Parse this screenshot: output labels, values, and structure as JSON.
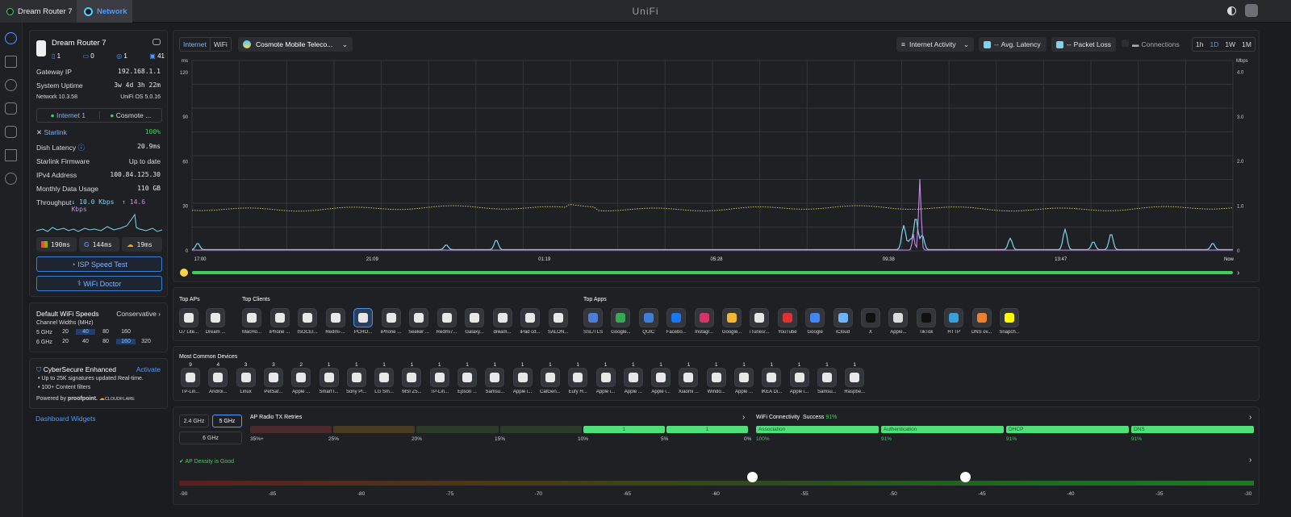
{
  "topbar": {
    "tab_router": "Dream Router 7",
    "tab_network": "Network",
    "brand": "UniFi"
  },
  "side_icons": [
    "dashboard-icon",
    "topology-icon",
    "devices-icon",
    "clients-icon",
    "insights-icon",
    "stats-icon",
    "protect-icon"
  ],
  "device": {
    "name": "Dream Router 7",
    "stats": [
      {
        "icon": "ap-icon",
        "value": "1"
      },
      {
        "icon": "switch-icon",
        "value": "0"
      },
      {
        "icon": "camera-icon",
        "value": "1"
      },
      {
        "icon": "clients-icon",
        "value": "41"
      }
    ],
    "gateway_ip_label": "Gateway IP",
    "gateway_ip": "192.168.1.1",
    "uptime_label": "System Uptime",
    "uptime": "3w 4d 3h 22m",
    "network_version": "Network 10.3.58",
    "os_version": "UniFi OS 5.0.16",
    "wan1": "Internet 1",
    "wan2": "Cosmote ...",
    "isp": "Starlink",
    "isp_pct": "100%",
    "dish_latency_label": "Dish Latency",
    "dish_latency": "20.9ms",
    "firmware_label": "Starlink Firmware",
    "firmware": "Up to date",
    "ipv4_label": "IPv4 Address",
    "ipv4": "100.84.125.30",
    "usage_label": "Monthly Data Usage",
    "usage": "110 GB",
    "throughput_label": "Throughput",
    "down": "10.0 Kbps",
    "up": "14.6 Kbps",
    "ping_ms": "190ms",
    "ping_google": "144ms",
    "ping_cf": "19ms",
    "speedtest": "ISP Speed Test",
    "wifidoctor": "WiFi Doctor"
  },
  "wifi_speeds": {
    "title": "Default WiFi Speeds",
    "mode": "Conservative",
    "channel_label": "Channel Widths (MHz)",
    "rows": [
      {
        "band": "5 GHz",
        "vals": [
          "20",
          "40",
          "80",
          "160"
        ],
        "sel": 1
      },
      {
        "band": "6 GHz",
        "vals": [
          "20",
          "40",
          "80",
          "160",
          "320"
        ],
        "sel": 3
      }
    ]
  },
  "cybersecure": {
    "title": "CyberSecure Enhanced",
    "action": "Activate",
    "b1": "Up to 25K signatures updated Real-time.",
    "b2": "100+ Content filters",
    "powered": "Powered by",
    "p1": "proofpoint.",
    "p2": "CLOUDFLARE"
  },
  "dashboard_widgets": "Dashboard Widgets",
  "chart_header": {
    "tab_internet": "Internet",
    "tab_wifi": "WiFi",
    "isp_select": "Cosmote Mobile Teleco...",
    "activity_select": "Internet Activity",
    "latency": "Avg. Latency",
    "loss": "Packet Loss",
    "connections": "Connections",
    "ranges": [
      "1h",
      "1D",
      "1W",
      "1M"
    ],
    "range_sel": "1D"
  },
  "chart_data": {
    "type": "line",
    "x_ticks": [
      "17:00",
      "21:09",
      "01:19",
      "05:28",
      "09:38",
      "13:47",
      "Now"
    ],
    "y_left_unit": "ms",
    "y_left_ticks": [
      "0",
      "30",
      "60",
      "90",
      "120"
    ],
    "y_right_unit": "Mbps",
    "y_right_ticks": [
      "0",
      "1.0",
      "2.0",
      "3.0",
      "4.0"
    ],
    "latency_color": "#c9c25a",
    "download_color": "#7fd3ea",
    "upload_color": "#c98be8"
  },
  "top_aps": {
    "title": "Top APs",
    "items": [
      {
        "label": "U7 Lite...",
        "icon": "ap-icon"
      },
      {
        "label": "Dream ...",
        "icon": "router-icon"
      }
    ]
  },
  "top_clients": {
    "title": "Top Clients",
    "items": [
      {
        "label": "MacHo...",
        "icon": "mac-icon"
      },
      {
        "label": "iPhone ...",
        "icon": "phone-icon"
      },
      {
        "label": "ISOCEI...",
        "icon": "laptop-icon"
      },
      {
        "label": "Redmi-...",
        "icon": "phone-icon"
      },
      {
        "label": "PCHO...",
        "icon": "pc-icon"
      },
      {
        "label": "iPhone ...",
        "icon": "phone-icon"
      },
      {
        "label": "Seeker ...",
        "icon": "tv-icon"
      },
      {
        "label": "Redmi7...",
        "icon": "phone-icon"
      },
      {
        "label": "Galaxy...",
        "icon": "phone-icon"
      },
      {
        "label": "dream...",
        "icon": "phone-icon"
      },
      {
        "label": "iPad cd...",
        "icon": "tablet-icon"
      },
      {
        "label": "SALON...",
        "icon": "box-icon"
      }
    ]
  },
  "top_apps": {
    "title": "Top Apps",
    "items": [
      {
        "label": "SSL/TLS",
        "color": "#4d7dd6"
      },
      {
        "label": "Google...",
        "color": "#34a853"
      },
      {
        "label": "QUIC",
        "color": "#3f7fd8"
      },
      {
        "label": "Facebo...",
        "color": "#1877f2"
      },
      {
        "label": "Instagr...",
        "color": "#d6336c"
      },
      {
        "label": "Google...",
        "color": "#f1b634"
      },
      {
        "label": "iTunes/...",
        "color": "#e6e6e6"
      },
      {
        "label": "YouTube",
        "color": "#e03131"
      },
      {
        "label": "Google",
        "color": "#4285f4"
      },
      {
        "label": "iCloud",
        "color": "#6fb3ff"
      },
      {
        "label": "X",
        "color": "#111111"
      },
      {
        "label": "Apple...",
        "color": "#dddddd"
      },
      {
        "label": "TikTok",
        "color": "#111111"
      },
      {
        "label": "HTTP",
        "color": "#3aa0d8"
      },
      {
        "label": "DNS ov...",
        "color": "#f08030"
      },
      {
        "label": "Snapch...",
        "color": "#fffc00"
      }
    ]
  },
  "common_devices": {
    "title": "Most Common Devices",
    "items": [
      {
        "label": "TP-Lin...",
        "count": "9"
      },
      {
        "label": "Androi...",
        "count": "4"
      },
      {
        "label": "Linux",
        "count": "3"
      },
      {
        "label": "PetSaf...",
        "count": "3"
      },
      {
        "label": "Apple ...",
        "count": "2"
      },
      {
        "label": "SmartT...",
        "count": "1"
      },
      {
        "label": "Sony Pl...",
        "count": "1"
      },
      {
        "label": "LG Sm...",
        "count": "1"
      },
      {
        "label": "MSI Z5...",
        "count": "1"
      },
      {
        "label": "TP-Lin...",
        "count": "1"
      },
      {
        "label": "Epson ...",
        "count": "1"
      },
      {
        "label": "Samsu...",
        "count": "1"
      },
      {
        "label": "Apple i...",
        "count": "1"
      },
      {
        "label": "CatGen...",
        "count": "1"
      },
      {
        "label": "Eufy H...",
        "count": "1"
      },
      {
        "label": "Apple i...",
        "count": "1"
      },
      {
        "label": "Apple ...",
        "count": "1"
      },
      {
        "label": "Apple i...",
        "count": "1"
      },
      {
        "label": "Xiaomi ...",
        "count": "1"
      },
      {
        "label": "Windo...",
        "count": "1"
      },
      {
        "label": "Apple ...",
        "count": "1"
      },
      {
        "label": "IKEA Di...",
        "count": "1"
      },
      {
        "label": "Apple i...",
        "count": "1"
      },
      {
        "label": "Samsu...",
        "count": "1"
      },
      {
        "label": "Raspbe...",
        "count": "1"
      }
    ]
  },
  "radio": {
    "band_24": "2.4 GHz",
    "band_5": "5 GHz",
    "band_6": "6 GHz",
    "title": "AP Radio TX Retries",
    "scale": [
      "35%+",
      "25%",
      "20%",
      "15%",
      "10%",
      "5%",
      "0%"
    ],
    "seg_values": [
      "",
      "",
      "",
      "",
      "1",
      "1"
    ]
  },
  "connectivity": {
    "title": "WiFi Connectivity",
    "success_label": "Success",
    "success_pct": "91%",
    "stages": [
      {
        "name": "Association",
        "pct": "100%"
      },
      {
        "name": "Authentication",
        "pct": "91%"
      },
      {
        "name": "DHCP",
        "pct": "91%"
      },
      {
        "name": "DNS",
        "pct": "91%"
      }
    ]
  },
  "density": {
    "title": "AP Density is Good",
    "ticks": [
      "-90",
      "-85",
      "-80",
      "-75",
      "-70",
      "-65",
      "-60",
      "-55",
      "-50",
      "-45",
      "-40",
      "-35",
      "-30"
    ],
    "markers": [
      -58,
      -46
    ]
  }
}
